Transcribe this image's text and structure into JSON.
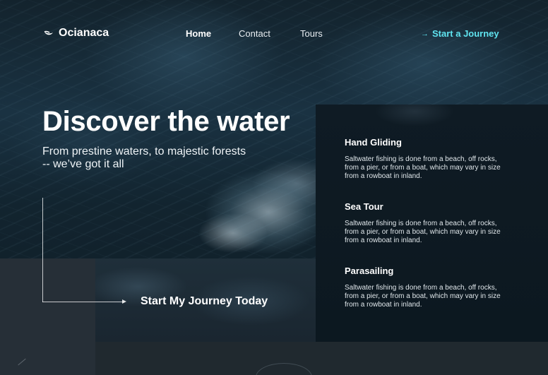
{
  "brand": {
    "name": "Ocianaca",
    "icon": "wave-logo-icon"
  },
  "nav": {
    "items": [
      {
        "label": "Home",
        "active": true
      },
      {
        "label": "Contact",
        "active": false
      },
      {
        "label": "Tours",
        "active": false
      }
    ],
    "cta": {
      "label": "Start a Journey",
      "icon": "arrow-right-icon",
      "color": "#5fe3ef"
    }
  },
  "hero": {
    "title": "Discover the water",
    "subtitle": "From prestine waters, to majestic forests -- we’ve got it all",
    "cta_label": "Start My Journey Today"
  },
  "activities": [
    {
      "title": "Hand Gliding",
      "description": "Saltwater fishing is done from a beach, off rocks, from a pier, or from a boat, which may vary in size from a rowboat in inland."
    },
    {
      "title": "Sea Tour",
      "description": "Saltwater fishing is done from a beach, off rocks, from a pier, or from a boat, which may vary in size from a rowboat in inland."
    },
    {
      "title": "Parasailing",
      "description": "Saltwater fishing is done from a beach, off rocks, from a pier, or from a boat, which may vary in size from a rowboat in inland."
    }
  ]
}
